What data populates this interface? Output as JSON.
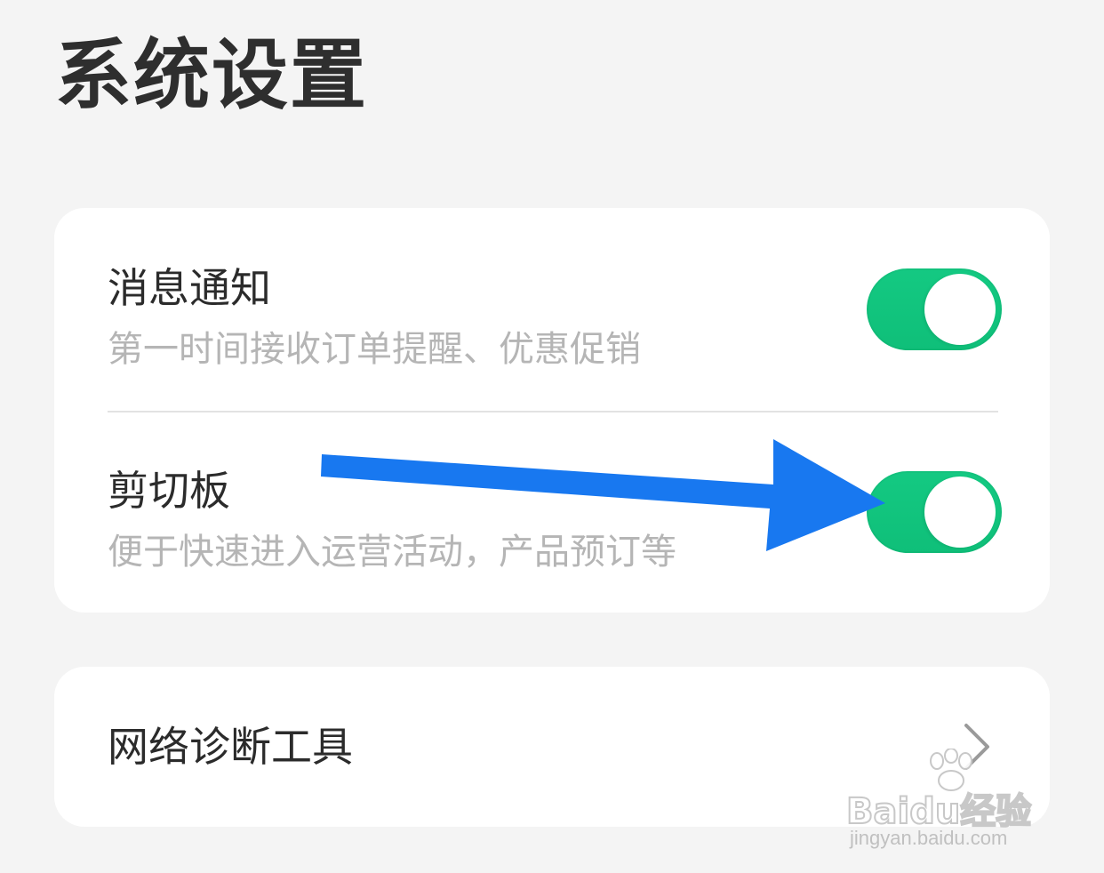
{
  "header": {
    "title": "系统设置"
  },
  "settings_card": {
    "rows": [
      {
        "title": "消息通知",
        "subtitle": "第一时间接收订单提醒、优惠促销",
        "toggle_on": true
      },
      {
        "title": "剪切板",
        "subtitle": "便于快速进入运营活动，产品预订等",
        "toggle_on": true
      }
    ]
  },
  "tools_card": {
    "title": "网络诊断工具",
    "icon": "chevron-right-icon"
  },
  "annotation": {
    "icon": "blue-arrow-icon",
    "color": "#1878f0"
  },
  "watermark": {
    "logo": "Baidu经验",
    "url": "jingyan.baidu.com"
  },
  "colors": {
    "background": "#f4f4f4",
    "card": "#ffffff",
    "toggle_on": "#10c47d",
    "title_text": "#2e2e2e",
    "subtitle_text": "#b5b5b5",
    "arrow": "#1878f0"
  }
}
